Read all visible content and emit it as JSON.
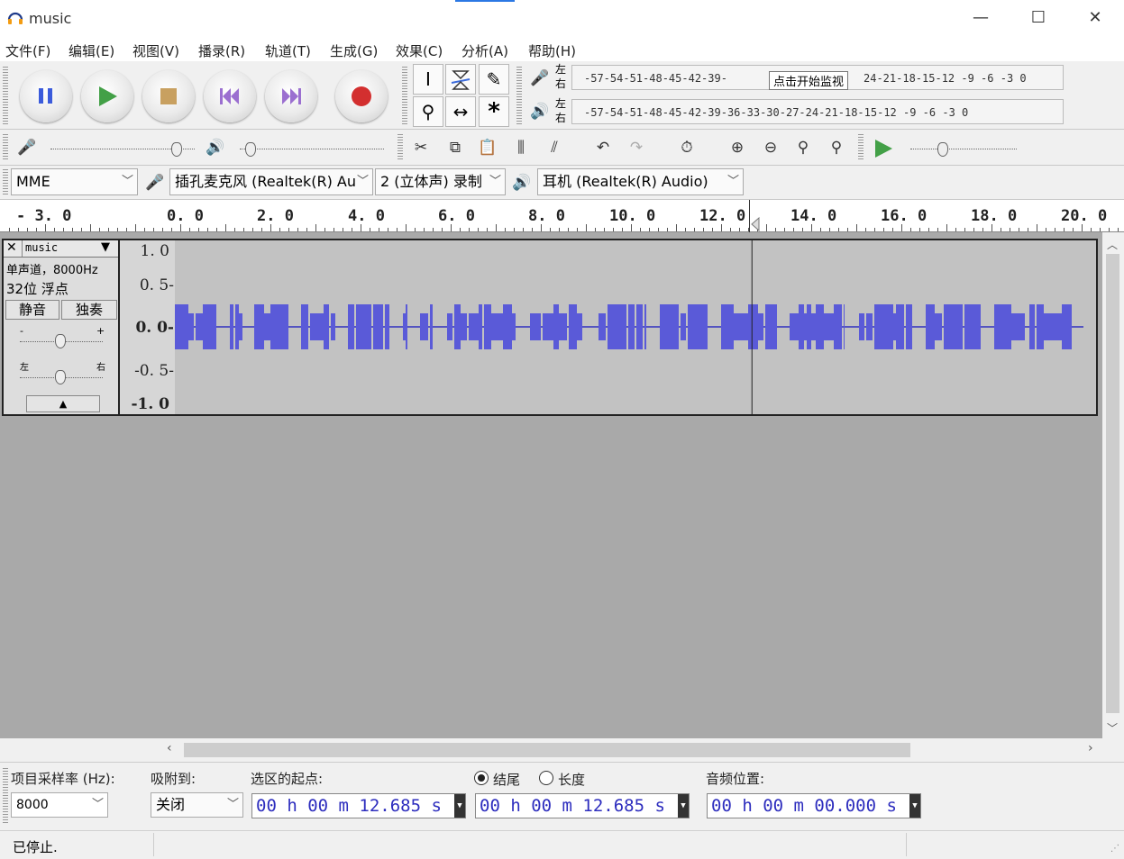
{
  "window": {
    "title": "music",
    "minimize": "—",
    "maximize": "☐",
    "close": "✕"
  },
  "menu": [
    "文件(F)",
    "编辑(E)",
    "视图(V)",
    "播录(R)",
    "轨道(T)",
    "生成(G)",
    "效果(C)",
    "分析(A)",
    "帮助(H)"
  ],
  "colors": {
    "waveform": "#5a5ad8",
    "wave_centerline": "#3030c0",
    "time_text": "#2d2dbe",
    "play_green": "#4caf50",
    "record_red": "#cc2222"
  },
  "meters": {
    "record_scale": "-57-54-51-48-45-42-39-",
    "record_scale_tail": "24-21-18-15-12 -9 -6 -3 0",
    "monitor_hint": "点击开始监视",
    "playback_scale": "-57-54-51-48-45-42-39-36-33-30-27-24-21-18-15-12 -9 -6 -3 0",
    "left": "左",
    "right": "右"
  },
  "devices": {
    "host": "MME",
    "input": "插孔麦克风 (Realtek(R) Au",
    "channels": "2 (立体声) 录制",
    "output": "耳机 (Realtek(R) Audio)"
  },
  "ruler": {
    "labels": [
      "- 3. 0",
      "0. 0",
      "2. 0",
      "4. 0",
      "6. 0",
      "8. 0",
      "10. 0",
      "12. 0",
      "14. 0",
      "16. 0",
      "18. 0",
      "20. 0"
    ],
    "playhead_seconds": 12.685
  },
  "track": {
    "name": "music",
    "info1": "单声道，8000Hz",
    "info2": "32位 浮点",
    "mute": "静音",
    "solo": "独奏",
    "gain_minus": "-",
    "gain_plus": "+",
    "pan_left": "左",
    "pan_right": "右",
    "scale": [
      "1. 0",
      "0. 5-",
      "0. 0-",
      "-0. 5-",
      "-1. 0"
    ]
  },
  "selection": {
    "rate_label": "项目采样率 (Hz):",
    "rate_value": "8000",
    "snap_label": "吸附到:",
    "snap_value": "关闭",
    "start_label": "选区的起点:",
    "end_label": "结尾",
    "length_label": "长度",
    "start_time": "00 h 00 m 12.685 s",
    "end_time": "00 h 00 m 12.685 s",
    "audio_pos_label": "音频位置:",
    "audio_pos": "00 h 00 m 00.000 s"
  },
  "status": "已停止."
}
